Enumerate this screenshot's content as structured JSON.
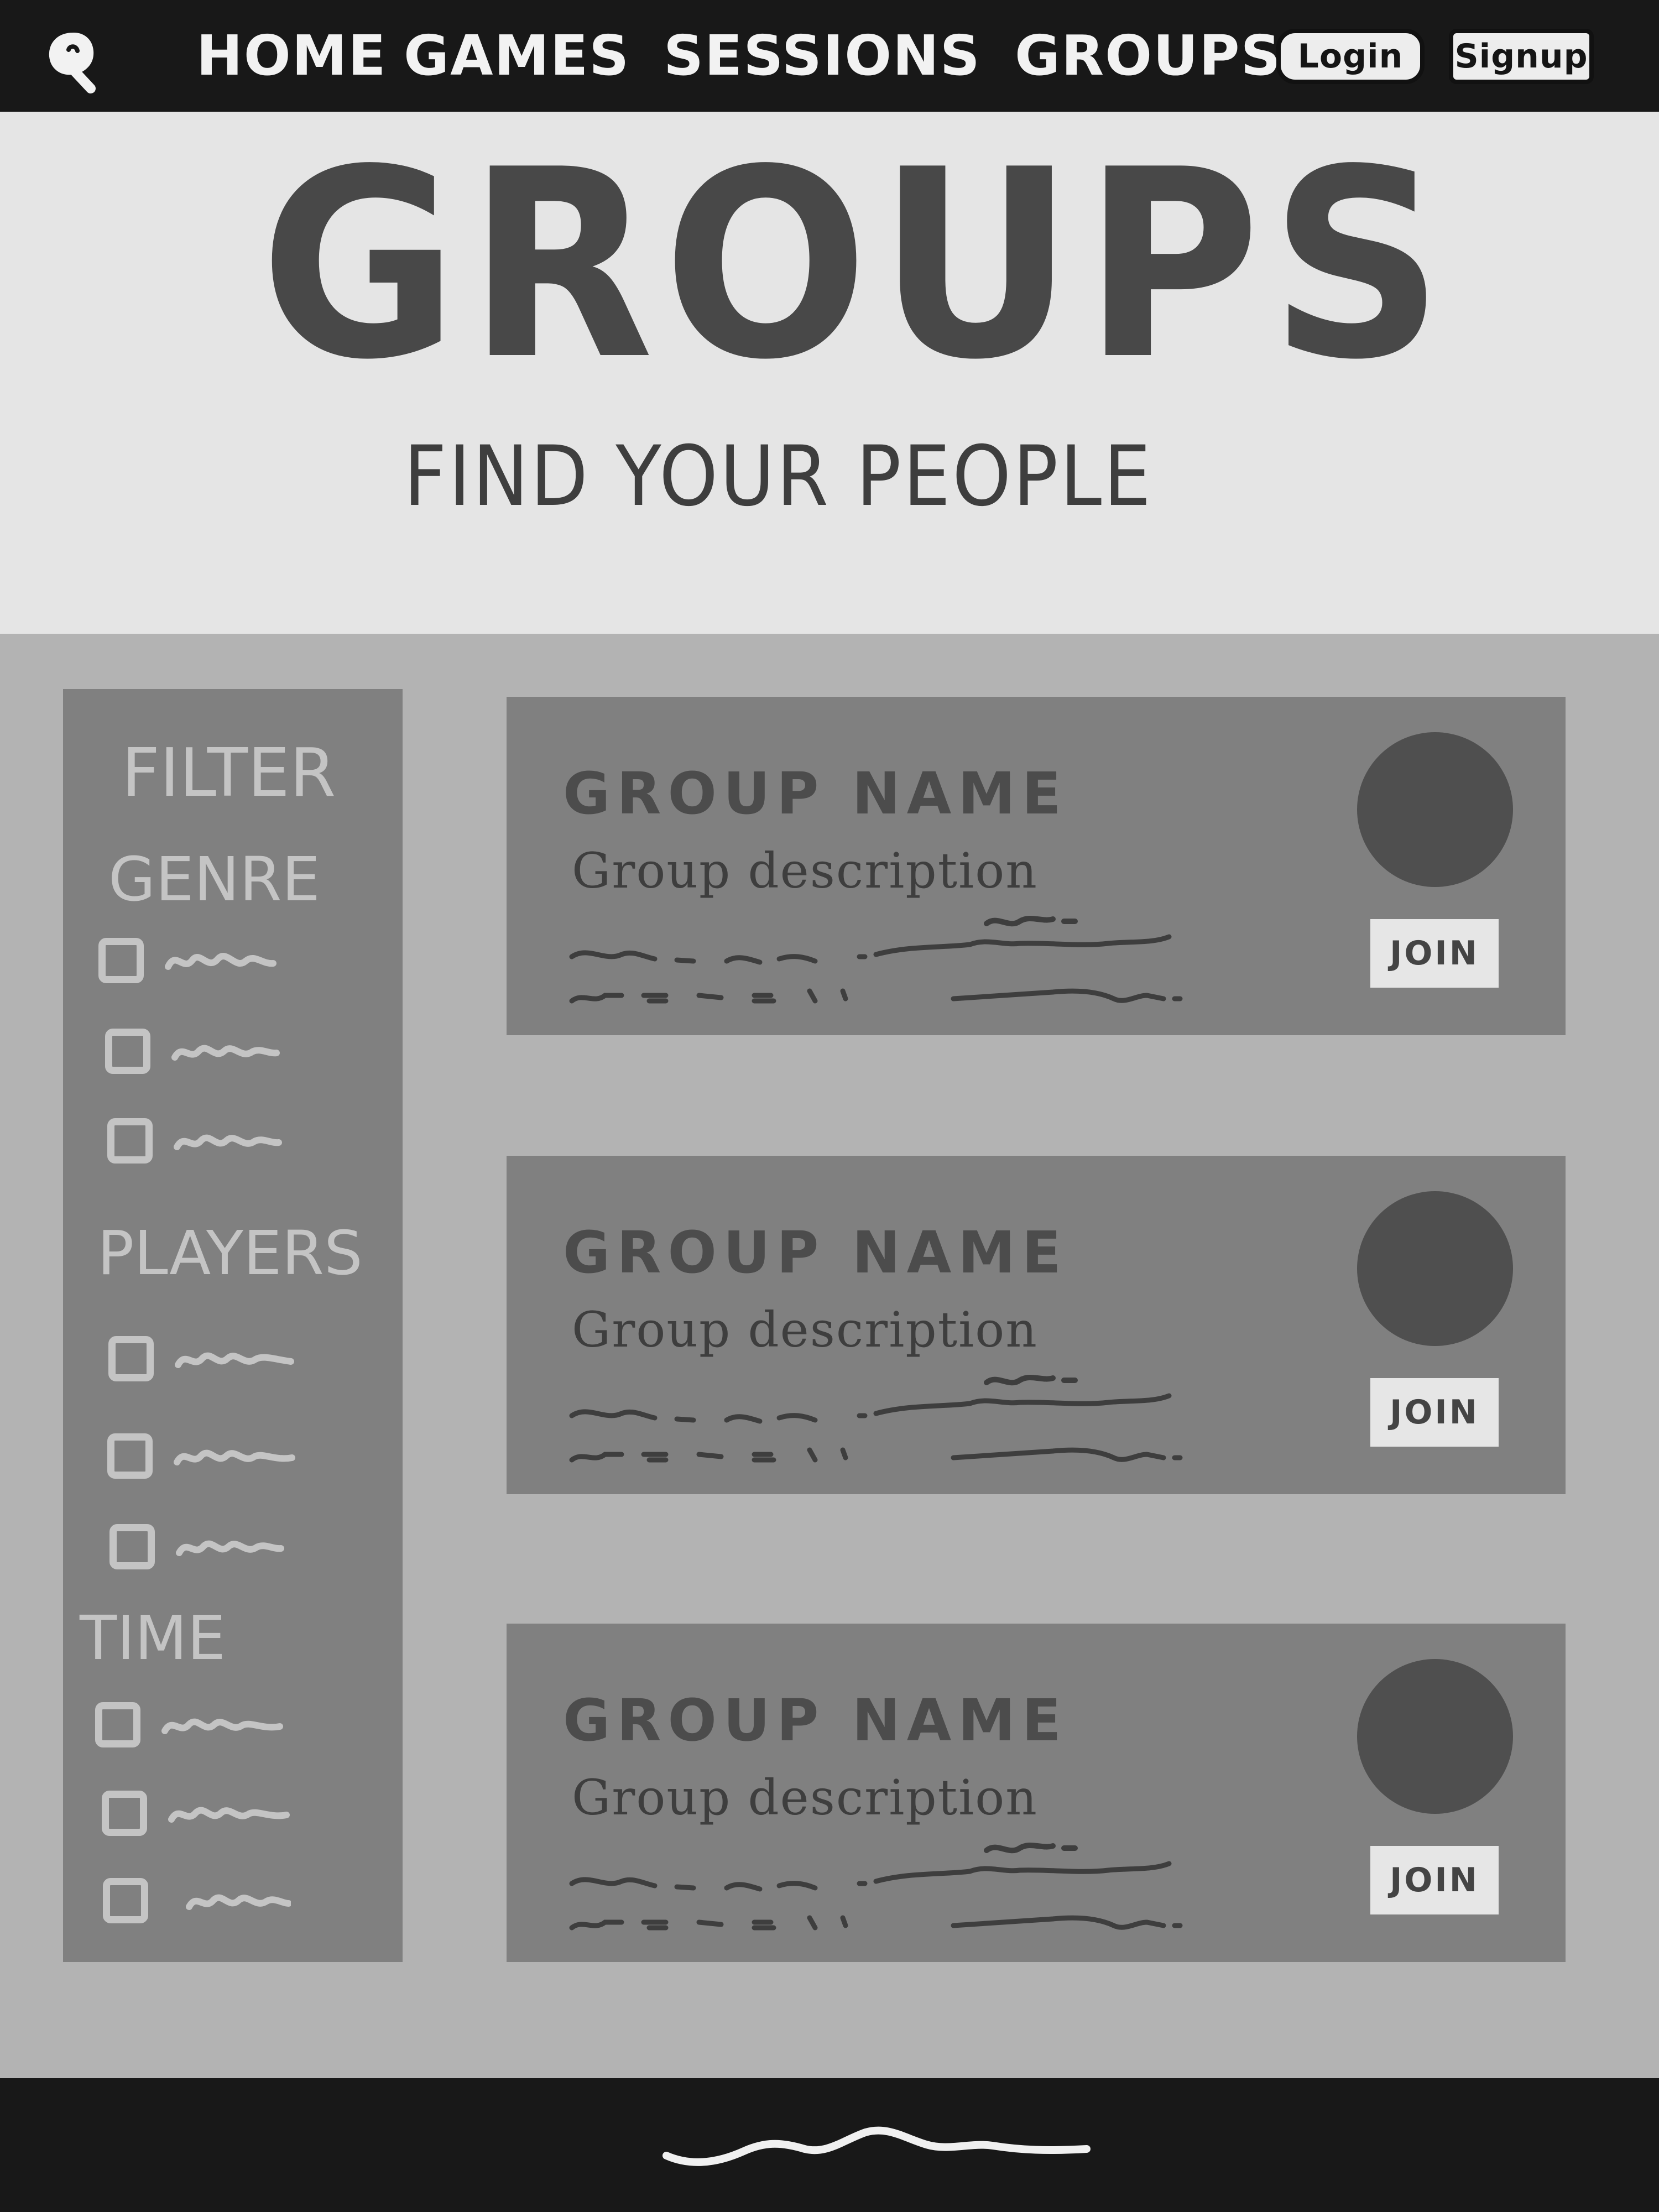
{
  "nav": {
    "logo_icon": "magnifier-logo-icon",
    "links": {
      "home": "Home",
      "games": "Games",
      "sessions": "Sessions",
      "groups": "Groups"
    },
    "login_label": "Login",
    "signup_label": "Signup"
  },
  "hero": {
    "title": "GROUPS",
    "subtitle": "Find Your People"
  },
  "filters": {
    "title": "Filter",
    "sections": {
      "genre": "Genre",
      "players": "Players",
      "time": "Time"
    }
  },
  "groups": [
    {
      "name": "Group Name",
      "description": "Group description",
      "join_label": "Join"
    },
    {
      "name": "Group Name",
      "description": "Group description",
      "join_label": "Join"
    },
    {
      "name": "Group Name",
      "description": "Group description",
      "join_label": "Join"
    }
  ],
  "colors": {
    "nav_bg": "#181818",
    "hero_bg": "#e5e5e5",
    "page_bg": "#b3b3b3",
    "panel_bg": "#808080",
    "avatar": "#4f4f4f",
    "button_bg": "#e6e6e6"
  }
}
